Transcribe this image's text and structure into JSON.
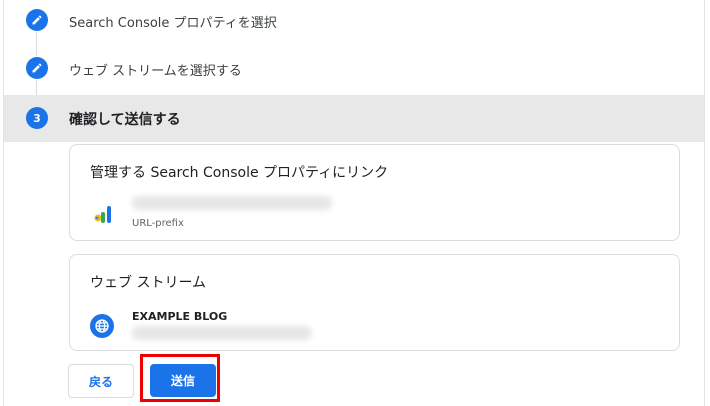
{
  "steps": [
    {
      "label": "Search Console プロパティを選択",
      "state": "completed",
      "icon": "pencil-icon"
    },
    {
      "label": "ウェブ ストリームを選択する",
      "state": "completed",
      "icon": "pencil-icon"
    },
    {
      "number": "3",
      "label": "確認して送信する",
      "state": "active"
    }
  ],
  "cards": {
    "search_console": {
      "title": "管理する Search Console プロパティにリンク",
      "property_type": "URL-prefix",
      "icon": "search-console-icon"
    },
    "web_stream": {
      "title": "ウェブ ストリーム",
      "stream_name": "EXAMPLE BLOG",
      "icon": "globe-icon"
    }
  },
  "buttons": {
    "back_label": "戻る",
    "submit_label": "送信"
  },
  "colors": {
    "accent": "#1a73e8",
    "active_step_bg": "#e8e8e8",
    "highlight": "#ee0000"
  }
}
